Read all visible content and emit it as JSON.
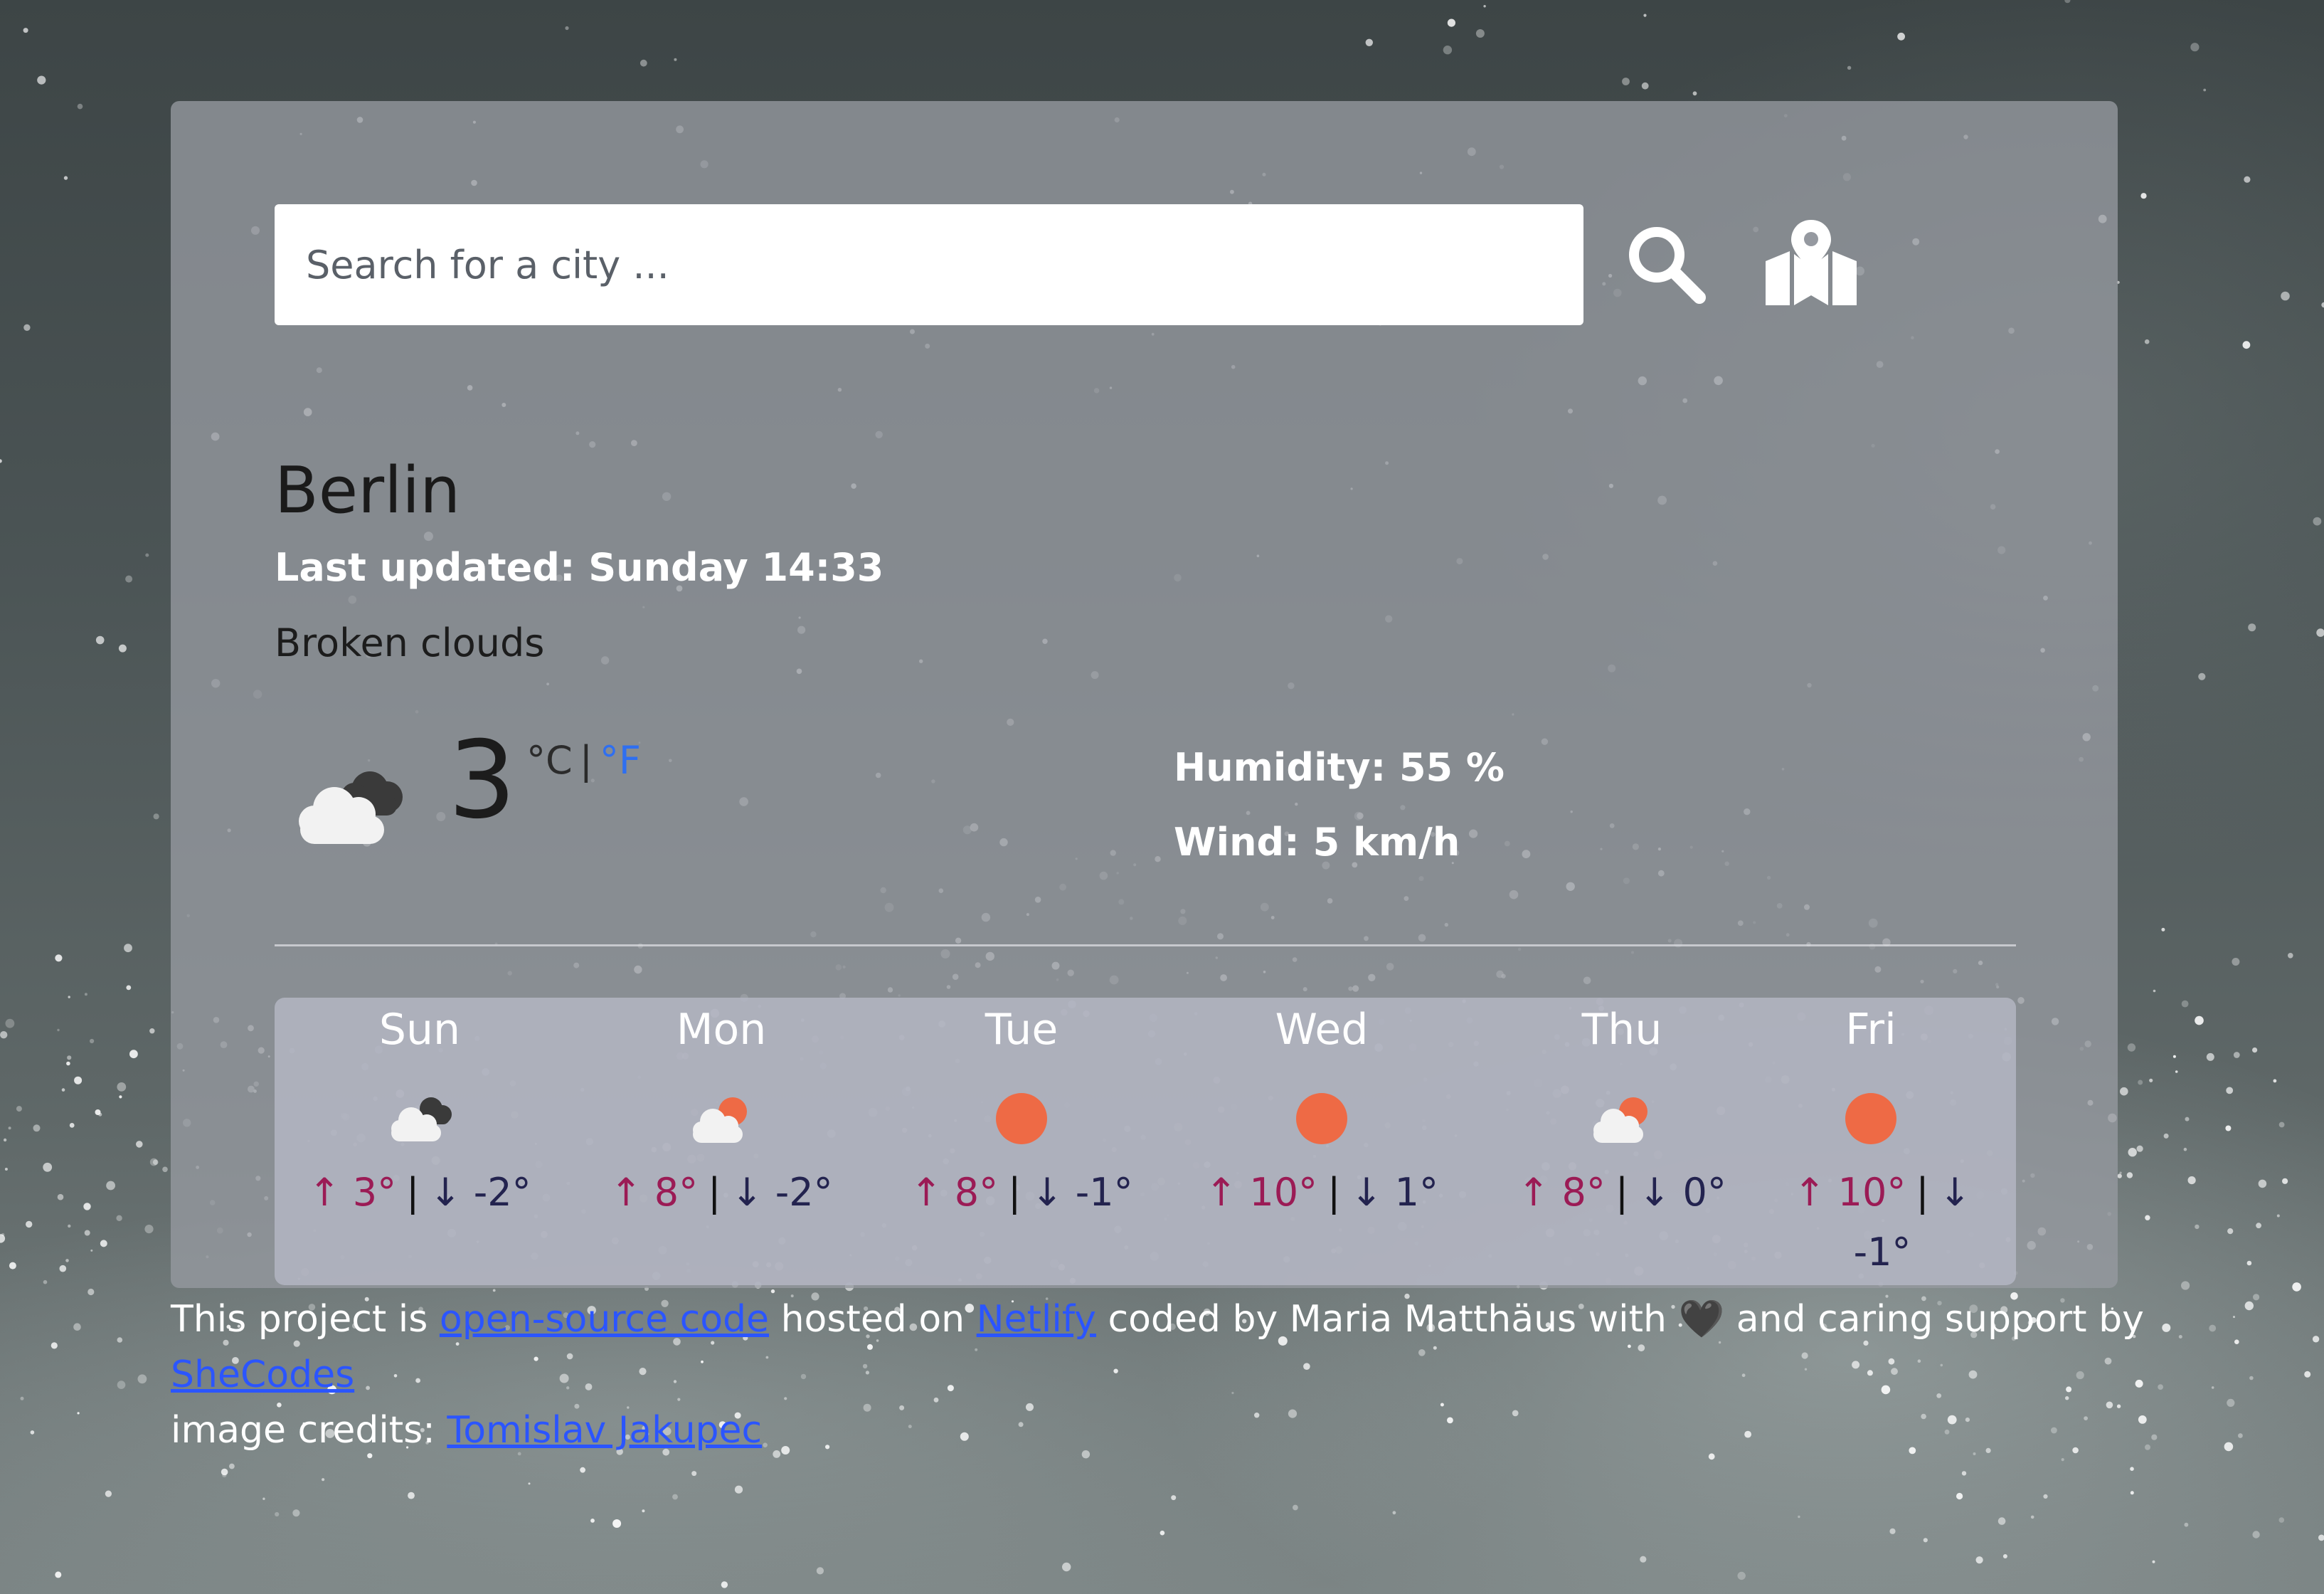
{
  "search": {
    "placeholder": "Search for a city ..."
  },
  "icons": {
    "search": "search-icon",
    "map": "map-pin-icon"
  },
  "current": {
    "city": "Berlin",
    "last_updated": "Last updated: Sunday 14:33",
    "description": "Broken clouds",
    "icon": "broken-clouds-icon",
    "temperature": "3",
    "unit_c": "°C",
    "unit_sep": "|",
    "unit_f": "°F",
    "humidity": "Humidity: 55 %",
    "wind": "Wind: 5 km/h"
  },
  "forecast": [
    {
      "day": "Sun",
      "icon": "broken-clouds-icon",
      "high": "↑ 3°",
      "sep": "|",
      "low": "↓ -2°"
    },
    {
      "day": "Mon",
      "icon": "few-clouds-sun-icon",
      "high": "↑ 8°",
      "sep": "|",
      "low": "↓ -2°"
    },
    {
      "day": "Tue",
      "icon": "clear-sun-icon",
      "high": "↑ 8°",
      "sep": "|",
      "low": "↓ -1°"
    },
    {
      "day": "Wed",
      "icon": "clear-sun-icon",
      "high": "↑ 10°",
      "sep": "|",
      "low": "↓ 1°"
    },
    {
      "day": "Thu",
      "icon": "few-clouds-sun-icon",
      "high": "↑ 8°",
      "sep": "|",
      "low": "↓ 0°"
    },
    {
      "day": "Fri",
      "icon": "clear-sun-icon",
      "high": "↑ 10°",
      "sep": "|",
      "low": "↓ -1°"
    }
  ],
  "footer": {
    "text1": "This project is",
    "link_source": "open-source code",
    "text2": "hosted on",
    "link_netlify": "Netlify",
    "text3": "coded by Maria Matthäus with",
    "heart": "🖤",
    "text4": "and caring support by",
    "link_shecodes": "SheCodes",
    "credits_text": "image credits:",
    "link_credits": "Tomislav Jakupec"
  },
  "colors": {
    "accent_link": "#2b55ff",
    "unit_f": "#2f6ff0",
    "temp_high": "#9b1b55",
    "temp_low": "#23234f",
    "sun": "#ee6a45"
  }
}
